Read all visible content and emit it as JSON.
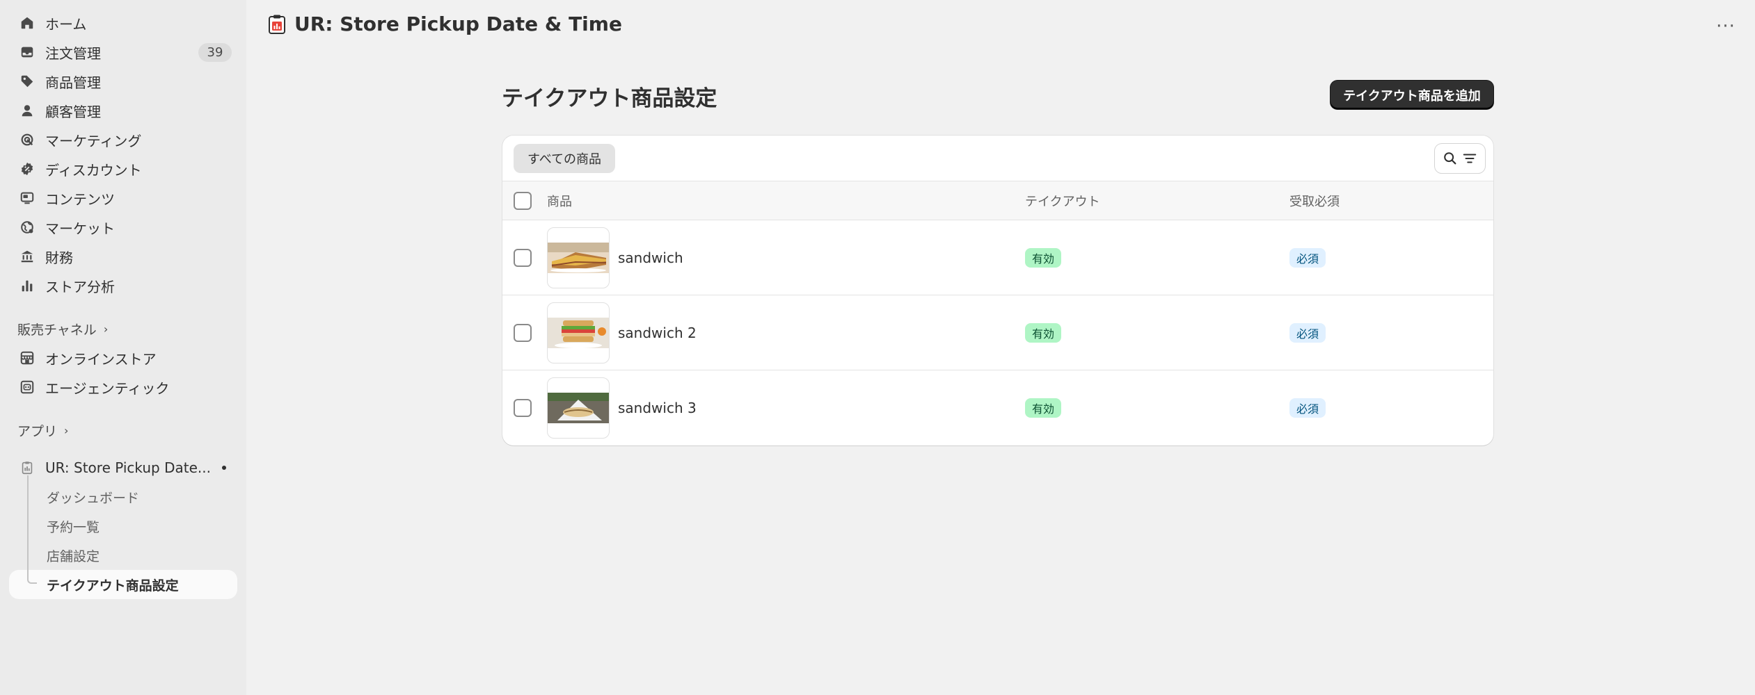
{
  "app": {
    "title": "UR: Store Pickup Date & Time",
    "more_label": "···"
  },
  "sidebar": {
    "items": [
      {
        "label": "ホーム",
        "icon": "home-icon"
      },
      {
        "label": "注文管理",
        "icon": "inbox-icon",
        "badge": "39"
      },
      {
        "label": "商品管理",
        "icon": "tag-icon"
      },
      {
        "label": "顧客管理",
        "icon": "person-icon"
      },
      {
        "label": "マーケティング",
        "icon": "target-icon"
      },
      {
        "label": "ディスカウント",
        "icon": "discount-icon"
      },
      {
        "label": "コンテンツ",
        "icon": "content-icon"
      },
      {
        "label": "マーケット",
        "icon": "globe-icon"
      },
      {
        "label": "財務",
        "icon": "bank-icon"
      },
      {
        "label": "ストア分析",
        "icon": "chart-icon"
      }
    ],
    "sales_channels_label": "販売チャネル",
    "channels": [
      {
        "label": "オンラインストア",
        "icon": "store-icon"
      },
      {
        "label": "エージェンティック",
        "icon": "robot-icon"
      }
    ],
    "apps_label": "アプリ",
    "app_item": {
      "label": "UR: Store Pickup Date...",
      "icon": "clipboard-icon"
    },
    "sub_items": [
      {
        "label": "ダッシュボード"
      },
      {
        "label": "予約一覧"
      },
      {
        "label": "店舗設定"
      },
      {
        "label": "テイクアウト商品設定"
      }
    ]
  },
  "main": {
    "page_title": "テイクアウト商品設定",
    "add_button_label": "テイクアウト商品を追加",
    "tab_all_label": "すべての商品",
    "columns": [
      "商品",
      "テイクアウト",
      "受取必須"
    ],
    "rows": [
      {
        "name": "sandwich",
        "takeout": "有効",
        "required": "必須"
      },
      {
        "name": "sandwich 2",
        "takeout": "有効",
        "required": "必須"
      },
      {
        "name": "sandwich 3",
        "takeout": "有効",
        "required": "必須"
      }
    ]
  },
  "colors": {
    "primary_button": "#303030",
    "takeout_badge_bg": "#aff5c5",
    "required_badge_bg": "#e0f0ff"
  }
}
